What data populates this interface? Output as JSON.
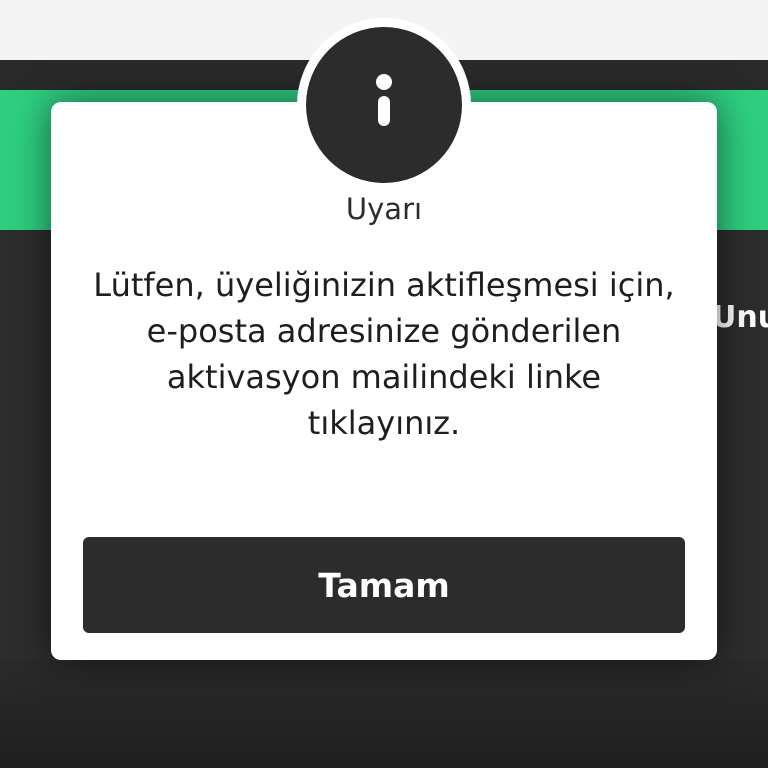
{
  "background": {
    "partial_text": "Unu"
  },
  "dialog": {
    "icon": "info-icon",
    "title": "Uyarı",
    "message": "Lütfen, üyeliğinizin aktifleşmesi için, e-posta adresinize gönderilen aktivasyon mailindeki linke tıklayınız.",
    "ok_label": "Tamam"
  },
  "colors": {
    "accent_green": "#2ecf80",
    "dark": "#2c2c2c",
    "surface": "#ffffff"
  }
}
